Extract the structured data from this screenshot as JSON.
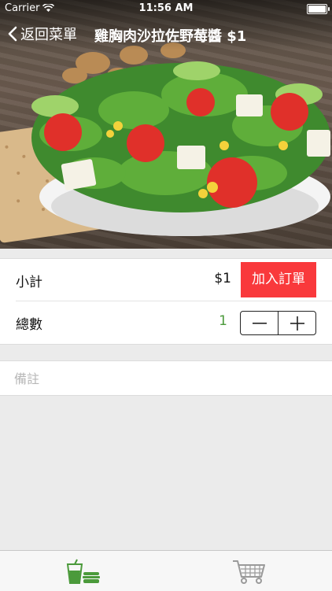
{
  "status_bar": {
    "carrier": "Carrier",
    "time": "11:56 AM"
  },
  "nav": {
    "back_label": "返回菜單",
    "title": "雞胸肉沙拉佐野莓醬 $1"
  },
  "order": {
    "subtotal_label": "小計",
    "subtotal_value": "$1",
    "add_button_label": "加入訂單",
    "quantity_label": "總數",
    "quantity_value": "1"
  },
  "note": {
    "placeholder": "備註",
    "value": ""
  },
  "tabs": [
    {
      "icon": "menu-drink-burger-icon",
      "active": true
    },
    {
      "icon": "shopping-cart-icon",
      "active": false
    }
  ],
  "colors": {
    "accent_red": "#f9393c",
    "active_green": "#4b9a3b",
    "inactive_gray": "#9a9a9a"
  }
}
